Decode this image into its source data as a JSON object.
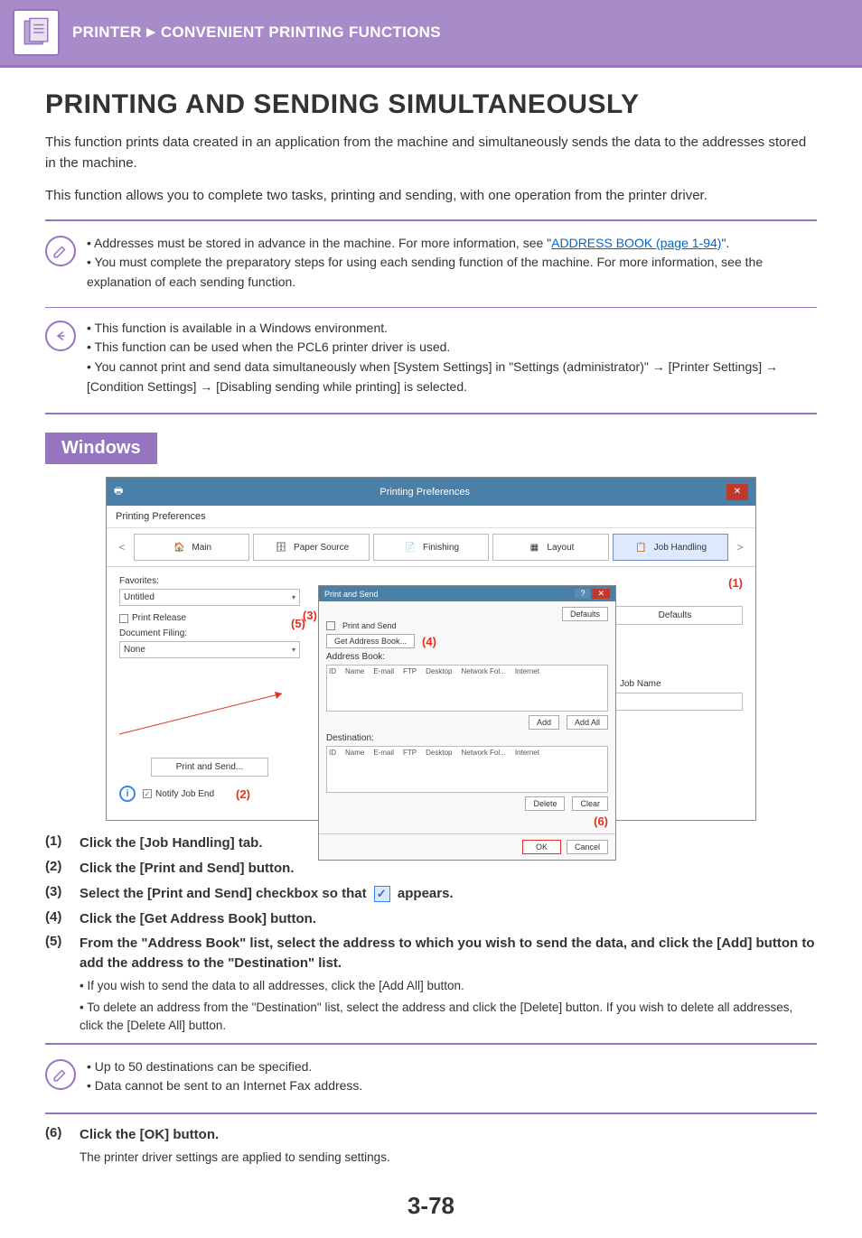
{
  "header": {
    "breadcrumb_part1": "PRINTER",
    "breadcrumb_part2": "CONVENIENT PRINTING FUNCTIONS"
  },
  "title": "PRINTING AND SENDING SIMULTANEOUSLY",
  "intro_p1": "This function prints data created in an application from the machine and simultaneously sends the data to the addresses stored in the machine.",
  "intro_p2": "This function allows you to complete two tasks, printing and sending, with one operation from the printer driver.",
  "note1": {
    "li1_pre": "Addresses must be stored in advance in the machine. For more information, see \"",
    "li1_link": "ADDRESS BOOK (page 1-94)",
    "li1_post": "\".",
    "li2": "You must complete the preparatory steps for using each sending function of the machine. For more information, see the explanation of each sending function."
  },
  "note2": {
    "li1": "This function is available in a Windows environment.",
    "li2": "This function can be used when the PCL6 printer driver is used.",
    "li3": "You cannot print and send data simultaneously when [System Settings] in \"Settings (administrator)\" → [Printer Settings] → [Condition Settings] → [Disabling sending while printing] is selected."
  },
  "section_label": "Windows",
  "window": {
    "title": "Printing Preferences",
    "subtitle": "Printing Preferences",
    "tabs": {
      "main": "Main",
      "paper_source": "Paper Source",
      "finishing": "Finishing",
      "layout": "Layout",
      "job_handling": "Job Handling"
    },
    "favorites_label": "Favorites:",
    "favorites_value": "Untitled",
    "defaults_btn": "Defaults",
    "print_release": "Print Release",
    "doc_filing_label": "Document Filing:",
    "doc_filing_value": "None",
    "job_name_label": "Job Name",
    "print_send_btn": "Print and Send...",
    "notify_label": "Notify Job End",
    "callouts": {
      "c1": "(1)",
      "c2": "(2)",
      "c3": "(3)",
      "c4": "(4)",
      "c5": "(5)",
      "c6": "(6)"
    },
    "dialog2": {
      "title": "Print and Send",
      "checkbox": "Print and Send",
      "get_ab": "Get Address Book...",
      "ab_label": "Address Book:",
      "defaults": "Defaults",
      "headers": {
        "id": "ID",
        "name": "Name",
        "email": "E-mail",
        "ftp": "FTP",
        "desktop": "Desktop",
        "netfol": "Network Fol...",
        "internet": "Internet"
      },
      "add": "Add",
      "add_all": "Add All",
      "dest_label": "Destination:",
      "delete": "Delete",
      "clear": "Clear",
      "ok": "OK",
      "cancel": "Cancel"
    }
  },
  "steps": {
    "s1": {
      "num": "(1)",
      "txt": "Click the [Job Handling] tab."
    },
    "s2": {
      "num": "(2)",
      "txt": "Click the [Print and Send] button."
    },
    "s3": {
      "num": "(3)",
      "txt_pre": "Select the [Print and Send] checkbox so that ",
      "txt_post": " appears."
    },
    "s4": {
      "num": "(4)",
      "txt": "Click the [Get Address Book] button."
    },
    "s5": {
      "num": "(5)",
      "txt": "From the \"Address Book\" list, select the address to which you wish to send the data, and click the [Add] button to add the address to the \"Destination\" list.",
      "sub1": "If you wish to send the data to all addresses, click the [Add All] button.",
      "sub2": "To delete an address from the \"Destination\" list, select the address and click the [Delete] button. If you wish to delete all addresses, click the [Delete All] button."
    },
    "s6": {
      "num": "(6)",
      "txt": "Click the [OK] button.",
      "sub": "The printer driver settings are applied to sending settings."
    }
  },
  "note3": {
    "li1": "Up to 50 destinations can be specified.",
    "li2": "Data cannot be sent to an Internet Fax address."
  },
  "page_number": "3-78"
}
